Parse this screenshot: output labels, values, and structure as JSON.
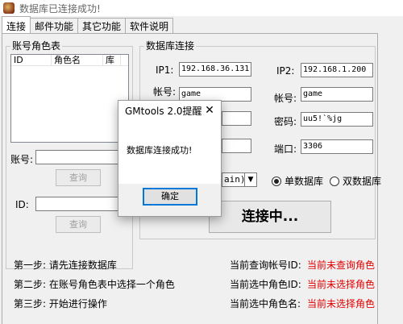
{
  "window": {
    "title": "数据库已连接成功!"
  },
  "tabs": [
    "连接",
    "邮件功能",
    "其它功能",
    "软件说明"
  ],
  "account_group": {
    "title": "账号角色表",
    "columns": [
      "ID",
      "角色名",
      "库"
    ],
    "account_label": "账号:",
    "query_label": "查询",
    "id_label": "ID:",
    "query2_label": "查询"
  },
  "db_group": {
    "title": "数据库连接",
    "ip1_label": "IP1:",
    "ip1_value": "192.168.36.131",
    "ip2_label": "IP2:",
    "ip2_value": "192.168.1.200",
    "acct_label": "帐号:",
    "acct_value": "game",
    "acct2_label": "帐号:",
    "acct2_value": "game",
    "pwd2_label": "密码:",
    "pwd2_value": "uu5!`%jg",
    "port_label": "端口:",
    "port_value": "3306",
    "db_select_value": "ain)",
    "radio_single": "单数据库",
    "radio_double": "双数据库",
    "connect_label": "连接中..."
  },
  "steps": [
    "第一步: 请先连接数据库",
    "第二步: 在账号角色表中选择一个角色",
    "第三步: 开始进行操作"
  ],
  "status": {
    "query_account_label": "当前查询帐号ID:",
    "query_account_value": "当前未查询角色",
    "selected_id_label": "当前选中角色ID:",
    "selected_id_value": "当前未选择角色",
    "selected_name_label": "当前选中角色名:",
    "selected_name_value": "当前未选择角色"
  },
  "dialog": {
    "title": "GMtools 2.0提醒",
    "message": "数据库连接成功!",
    "ok_label": "确定"
  }
}
